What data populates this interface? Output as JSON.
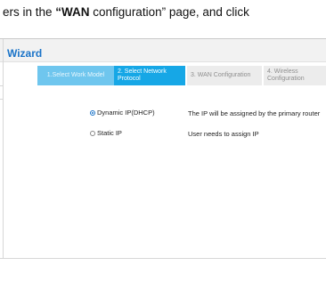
{
  "instruction": {
    "prefix": "ers in the ",
    "bold": "“WAN",
    "suffix": " configuration” page, and  click"
  },
  "wizard": {
    "title": "Wizard",
    "steps": [
      {
        "label": "1.Select Work Model",
        "state": "done"
      },
      {
        "label": "2. Select Network Protocol",
        "state": "active"
      },
      {
        "label": "3. WAN Configuration",
        "state": "todo"
      },
      {
        "label": "4. Wireless Configuration",
        "state": "todo"
      }
    ],
    "options": [
      {
        "label": "Dynamic IP(DHCP)",
        "selected": true,
        "description": "The IP will be assigned by the primary router"
      },
      {
        "label": "Static IP",
        "selected": false,
        "description": "User needs to assign IP"
      }
    ]
  },
  "colors": {
    "accent": "#1a73c8",
    "step_active": "#16a7e6",
    "step_done": "#6fc6ee",
    "step_todo": "#ececec"
  }
}
